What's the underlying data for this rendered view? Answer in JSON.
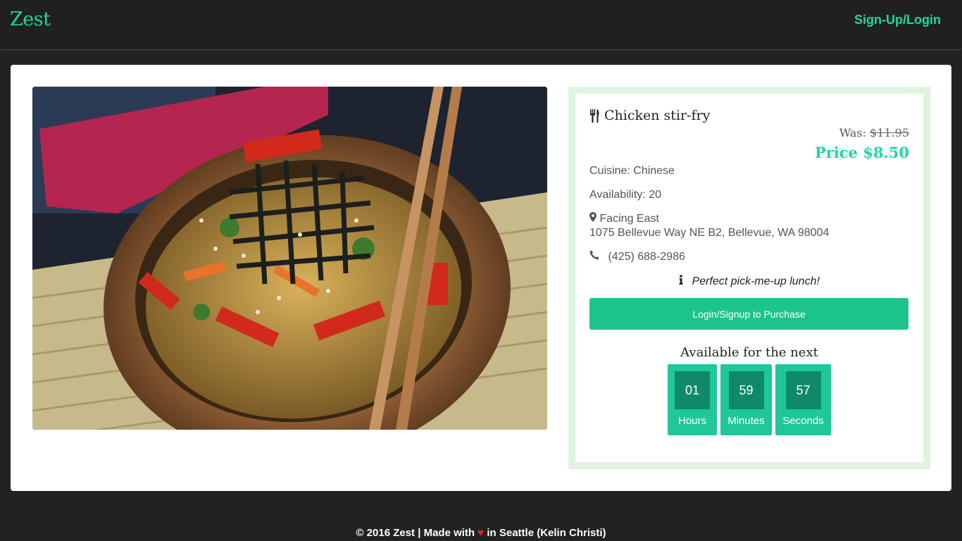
{
  "navbar": {
    "brand": "Zest",
    "login_link": "Sign-Up/Login"
  },
  "item": {
    "image_alt": "stir-fry noodles in wooden bowl with chopsticks",
    "title": "Chicken stir-fry",
    "was_label": "Was:",
    "was_price": "$11.95",
    "price": "Price $8.50",
    "cuisine": "Cuisine: Chinese",
    "availability": "Availability: 20",
    "restaurant": "Facing East",
    "address": "1075 Bellevue Way NE B2, Bellevue, WA 98004",
    "phone": "(425) 688-2986",
    "note": "Perfect pick-me-up lunch!",
    "buy_button": "Login/Signup to Purchase",
    "available_label": "Available for the next"
  },
  "timer": [
    {
      "value": "01",
      "label": "Hours"
    },
    {
      "value": "59",
      "label": "Minutes"
    },
    {
      "value": "57",
      "label": "Seconds"
    }
  ],
  "footer": {
    "prefix": "© 2016 Zest | Made with",
    "suffix": "in Seattle (Kelin Christi)"
  },
  "colors": {
    "accent": "#1ed8a1",
    "button": "#1dc38c",
    "timer_box": "#1fc79a",
    "timer_value_bg": "#0e8a68",
    "info_border": "#dff4dc",
    "heart": "#e0201e"
  },
  "icons": {
    "title": "cutlery-icon",
    "restaurant": "map-marker-icon",
    "phone": "phone-icon",
    "note": "info-icon",
    "footer": "heart-icon"
  }
}
